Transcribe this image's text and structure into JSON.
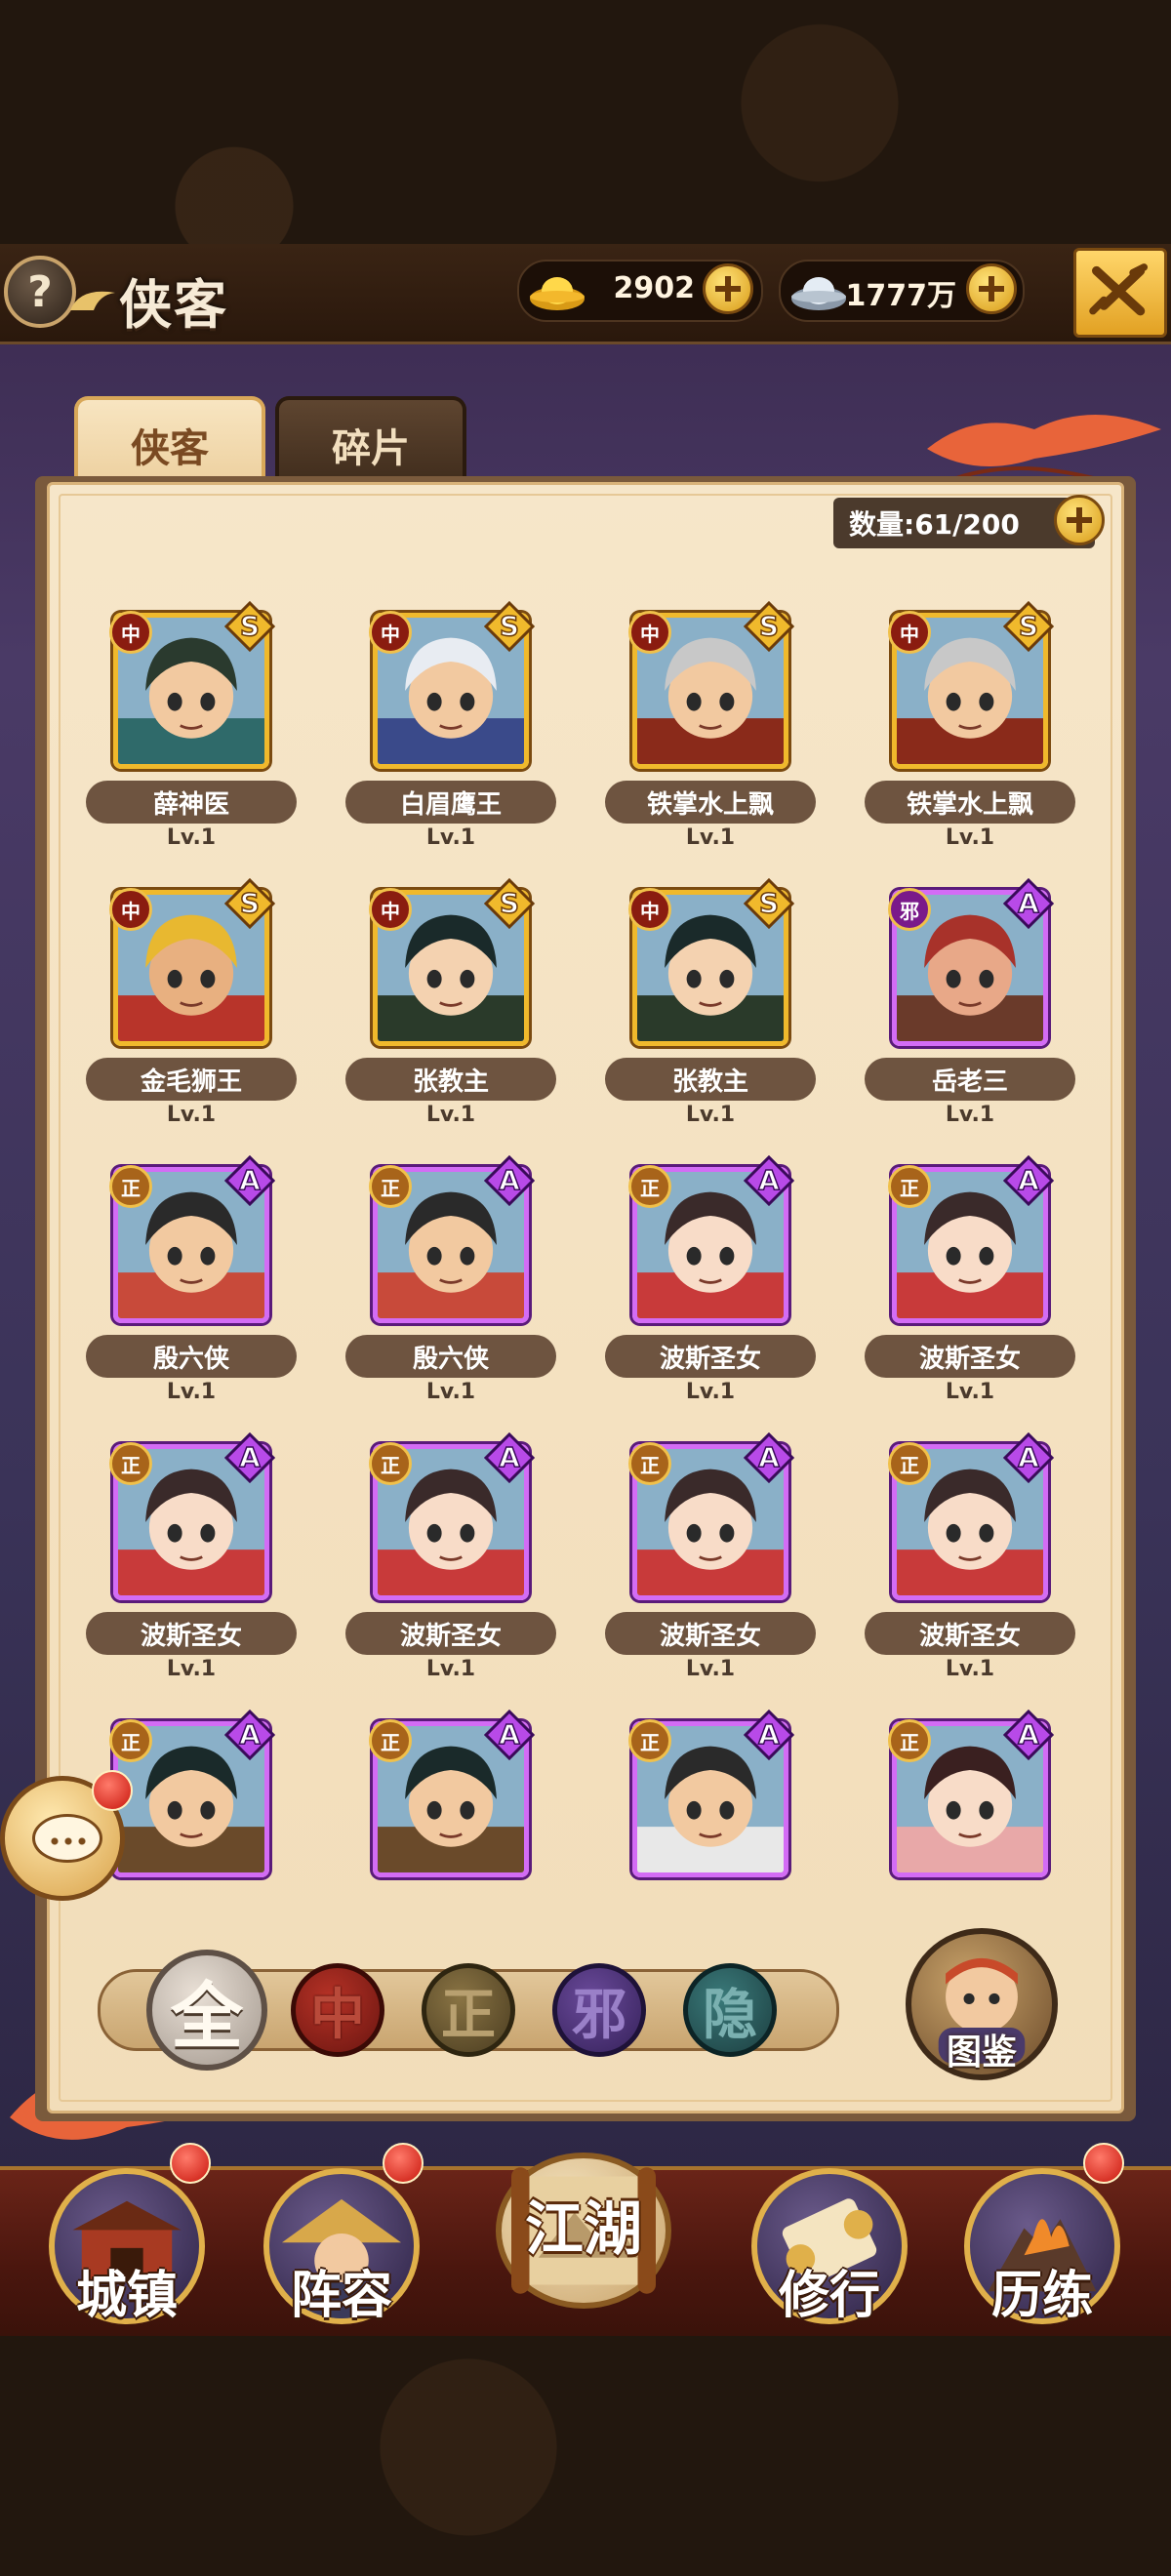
{
  "header": {
    "help_icon": "question-icon",
    "title": "侠客",
    "gold": {
      "icon": "gold-ingot-icon",
      "value": "2902"
    },
    "silver": {
      "icon": "silver-ingot-icon",
      "value": "1777万"
    },
    "close_icon": "crossed-sword-icon"
  },
  "tabs": [
    {
      "label": "侠客",
      "active": true
    },
    {
      "label": "碎片",
      "active": false
    }
  ],
  "roster": {
    "count_label": "数量:61/200"
  },
  "heroes": [
    {
      "name": "薛神医",
      "level": "Lv.1",
      "faction": "中",
      "rank": "S",
      "frame": "gold",
      "skin": "#f2c9a0",
      "hair": "#2a3a2e",
      "robe": "#2f6a6a"
    },
    {
      "name": "白眉鹰王",
      "level": "Lv.1",
      "faction": "中",
      "rank": "S",
      "frame": "gold",
      "skin": "#f2c9a0",
      "hair": "#e8ecf2",
      "robe": "#3a4a8a"
    },
    {
      "name": "铁掌水上飘",
      "level": "Lv.1",
      "faction": "中",
      "rank": "S",
      "frame": "gold",
      "skin": "#f2c9a0",
      "hair": "#c8c8c8",
      "robe": "#8a2a1a"
    },
    {
      "name": "铁掌水上飘",
      "level": "Lv.1",
      "faction": "中",
      "rank": "S",
      "frame": "gold",
      "skin": "#f2c9a0",
      "hair": "#c8c8c8",
      "robe": "#8a2a1a"
    },
    {
      "name": "金毛狮王",
      "level": "Lv.1",
      "faction": "中",
      "rank": "S",
      "frame": "gold",
      "skin": "#e8b080",
      "hair": "#e8b830",
      "robe": "#b8342a"
    },
    {
      "name": "张教主",
      "level": "Lv.1",
      "faction": "中",
      "rank": "S",
      "frame": "gold",
      "skin": "#f4d2b0",
      "hair": "#1a2a2a",
      "robe": "#2a3a2a"
    },
    {
      "name": "张教主",
      "level": "Lv.1",
      "faction": "中",
      "rank": "S",
      "frame": "gold",
      "skin": "#f4d2b0",
      "hair": "#1a2a2a",
      "robe": "#2a3a2a"
    },
    {
      "name": "岳老三",
      "level": "Lv.1",
      "faction": "邪",
      "rank": "A",
      "frame": "purple",
      "skin": "#e8a888",
      "hair": "#a8322a",
      "robe": "#6a3a2a"
    },
    {
      "name": "殷六侠",
      "level": "Lv.1",
      "faction": "正",
      "rank": "A",
      "frame": "purple",
      "skin": "#f2c9a0",
      "hair": "#2a2a2a",
      "robe": "#c84a3a"
    },
    {
      "name": "殷六侠",
      "level": "Lv.1",
      "faction": "正",
      "rank": "A",
      "frame": "purple",
      "skin": "#f2c9a0",
      "hair": "#2a2a2a",
      "robe": "#c84a3a"
    },
    {
      "name": "波斯圣女",
      "level": "Lv.1",
      "faction": "正",
      "rank": "A",
      "frame": "purple",
      "skin": "#f8dcc8",
      "hair": "#3a2a2a",
      "robe": "#c83a3a"
    },
    {
      "name": "波斯圣女",
      "level": "Lv.1",
      "faction": "正",
      "rank": "A",
      "frame": "purple",
      "skin": "#f8dcc8",
      "hair": "#3a2a2a",
      "robe": "#c83a3a"
    },
    {
      "name": "波斯圣女",
      "level": "Lv.1",
      "faction": "正",
      "rank": "A",
      "frame": "purple",
      "skin": "#f8dcc8",
      "hair": "#3a2a2a",
      "robe": "#c83a3a"
    },
    {
      "name": "波斯圣女",
      "level": "Lv.1",
      "faction": "正",
      "rank": "A",
      "frame": "purple",
      "skin": "#f8dcc8",
      "hair": "#3a2a2a",
      "robe": "#c83a3a"
    },
    {
      "name": "波斯圣女",
      "level": "Lv.1",
      "faction": "正",
      "rank": "A",
      "frame": "purple",
      "skin": "#f8dcc8",
      "hair": "#3a2a2a",
      "robe": "#c83a3a"
    },
    {
      "name": "波斯圣女",
      "level": "Lv.1",
      "faction": "正",
      "rank": "A",
      "frame": "purple",
      "skin": "#f8dcc8",
      "hair": "#3a2a2a",
      "robe": "#c83a3a"
    },
    {
      "name": "",
      "level": "",
      "faction": "正",
      "rank": "A",
      "frame": "purple",
      "skin": "#f2c9a0",
      "hair": "#1a2a2a",
      "robe": "#6a4a2a"
    },
    {
      "name": "",
      "level": "",
      "faction": "正",
      "rank": "A",
      "frame": "purple",
      "skin": "#f2c9a0",
      "hair": "#1a2a2a",
      "robe": "#6a4a2a"
    },
    {
      "name": "",
      "level": "",
      "faction": "正",
      "rank": "A",
      "frame": "purple",
      "skin": "#f2c9a0",
      "hair": "#2a2a2a",
      "robe": "#e8e8e8"
    },
    {
      "name": "",
      "level": "",
      "faction": "正",
      "rank": "A",
      "frame": "purple",
      "skin": "#f8dcc8",
      "hair": "#3a2020",
      "robe": "#e8a8a8"
    }
  ],
  "filters": [
    {
      "label": "全",
      "selected": true
    },
    {
      "label": "中",
      "selected": false
    },
    {
      "label": "正",
      "selected": false
    },
    {
      "label": "邪",
      "selected": false
    },
    {
      "label": "隐",
      "selected": false
    }
  ],
  "atlas": {
    "label": "图鉴"
  },
  "chat": {
    "icon": "chat-bubble-icon",
    "has_notification": true
  },
  "nav": [
    {
      "label": "城镇",
      "icon": "town-gate-icon",
      "has_notification": true
    },
    {
      "label": "阵容",
      "icon": "straw-hat-icon",
      "has_notification": true
    },
    {
      "label": "江湖",
      "icon": "scroll-icon",
      "has_notification": false
    },
    {
      "label": "修行",
      "icon": "training-scroll-icon",
      "has_notification": false
    },
    {
      "label": "历练",
      "icon": "volcano-icon",
      "has_notification": true
    }
  ],
  "colors": {
    "gold_frame": "#f0b92c",
    "purple_frame": "#d36cf5",
    "panel": "#f6e6c9",
    "nav_bg": "#5a1c12"
  }
}
